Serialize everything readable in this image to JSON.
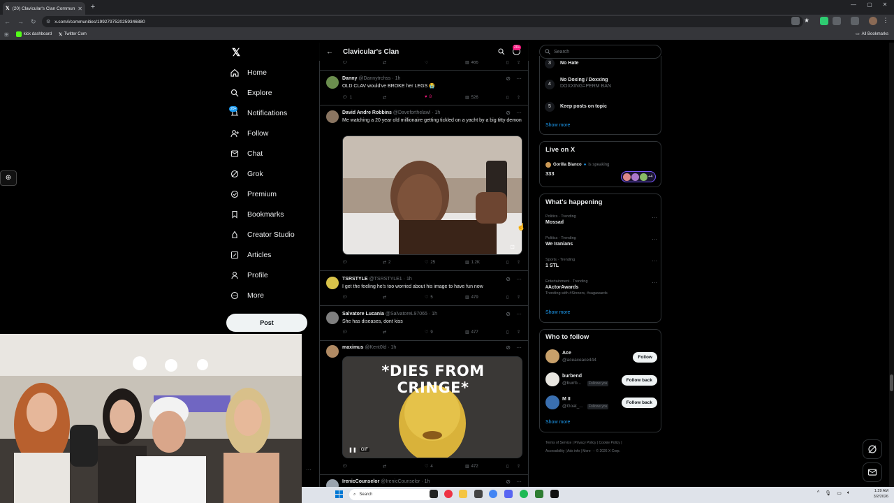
{
  "browser": {
    "tab_title": "(20) Clavicular's Clan Community",
    "url": "x.com/i/communities/1992797520259346880",
    "bookmarks": [
      "kick dashboard",
      "Twitter Com"
    ],
    "all_bookmarks": "All Bookmarks"
  },
  "nav": {
    "items": [
      "Home",
      "Explore",
      "Notifications",
      "Follow",
      "Chat",
      "Grok",
      "Premium",
      "Bookmarks",
      "Creator Studio",
      "Articles",
      "Profile",
      "More"
    ],
    "notif_badge": "20+",
    "post_label": "Post"
  },
  "feed": {
    "title": "Clavicular's Clan",
    "badge": "20+",
    "top_actions": {
      "views": "466"
    },
    "posts": [
      {
        "name": "Danny",
        "handle": "@Dannytrchss",
        "time": "1h",
        "text": "OLD CLAV would've BROKE her LEGS 😭",
        "replies": "1",
        "reposts": "",
        "likes": "8",
        "views": "526"
      },
      {
        "name": "David Andre Robbins",
        "handle": "@Daveforthelawl",
        "time": "1h",
        "text": "Me watching a 20 year old millionaire getting tickled on a yacht by a big titty demon",
        "replies": "",
        "reposts": "2",
        "likes": "25",
        "views": "1.2K"
      },
      {
        "name": "TSRSTYLE",
        "handle": "@TSRSTYLE1",
        "time": "1h",
        "text": "I get the feeling he's too worried about his image to have fun now",
        "replies": "",
        "reposts": "",
        "likes": "5",
        "views": "479"
      },
      {
        "name": "Salvatore Lucania",
        "handle": "@SalvatoreL97065",
        "time": "1h",
        "text": "She has diseases, dont kiss",
        "replies": "",
        "reposts": "",
        "likes": "9",
        "views": "477"
      },
      {
        "name": "maximus",
        "handle": "@Kent0ld",
        "time": "1h",
        "text": "",
        "media_caption": "*DIES FROM CRINGE*",
        "gif_label": "GIF",
        "replies": "",
        "reposts": "",
        "likes": "4",
        "views": "472"
      },
      {
        "name": "IrenicCounselor",
        "handle": "@IrenicCounselor",
        "time": "1h"
      }
    ]
  },
  "right": {
    "search_placeholder": "Search",
    "rules": [
      {
        "num": "3",
        "title": "No Hate",
        "desc": ""
      },
      {
        "num": "4",
        "title": "No Doxing / Doxxing",
        "desc": "DOXXING=PERM BAN"
      },
      {
        "num": "5",
        "title": "Keep posts on topic",
        "desc": ""
      }
    ],
    "show_more": "Show more",
    "live": {
      "title": "Live on X",
      "host": "Gorilla Blanco",
      "status": "is speaking",
      "listeners": "333",
      "extra": "+4"
    },
    "happening": {
      "title": "What's happening",
      "trends": [
        {
          "context": "Politics · Trending",
          "name": "Mossad",
          "with": ""
        },
        {
          "context": "Politics · Trending",
          "name": "We Iranians",
          "with": ""
        },
        {
          "context": "Sports · Trending",
          "name": "1 STL",
          "with": ""
        },
        {
          "context": "Entertainment · Trending",
          "name": "#ActorAwards",
          "with": "Trending with #Sinners, #sagawards"
        }
      ]
    },
    "who_to_follow": {
      "title": "Who to follow",
      "users": [
        {
          "name": "Ace",
          "handle": "@aceaceace444",
          "follows_you": "",
          "button": "Follow"
        },
        {
          "name": "burbend",
          "handle": "@burrb...",
          "follows_you": "Follows you",
          "button": "Follow back"
        },
        {
          "name": "M II",
          "handle": "@Goat_...",
          "follows_you": "Follows you",
          "button": "Follow back"
        }
      ]
    },
    "footer": [
      "Terms of Service",
      "Privacy Policy",
      "Cookie Policy",
      "Accessibility",
      "Ads info",
      "More ···",
      "© 2026 X Corp."
    ]
  },
  "taskbar": {
    "search": "Search",
    "time": "1:29 AM",
    "date": "3/2/2026"
  },
  "colors": {
    "accent": "#1d9bf0",
    "like": "#f91880",
    "bg": "#000000",
    "border": "#2f3336"
  }
}
